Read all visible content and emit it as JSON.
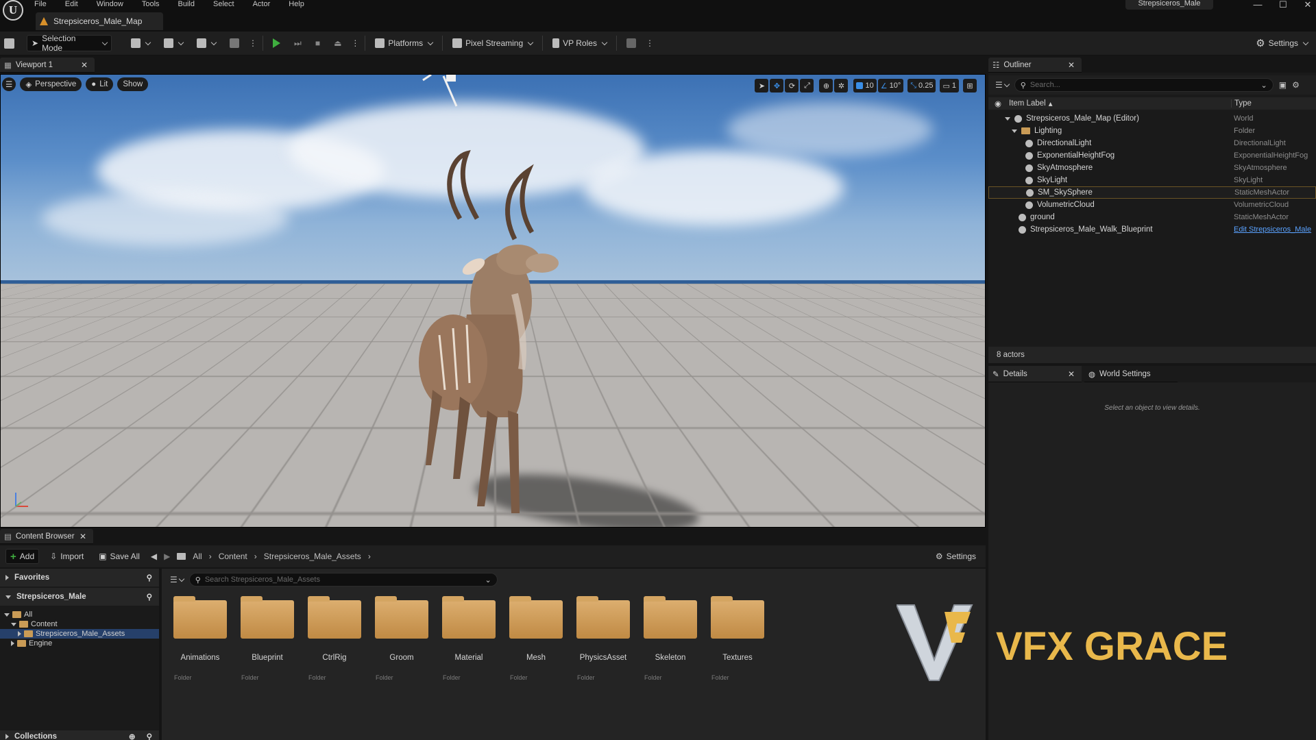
{
  "menu": [
    "File",
    "Edit",
    "Window",
    "Tools",
    "Build",
    "Select",
    "Actor",
    "Help"
  ],
  "map_tab": "Strepsiceros_Male_Map",
  "project_title": "Strepsiceros_Male",
  "toolbar": {
    "selection_mode": "Selection Mode",
    "platforms": "Platforms",
    "pixel_streaming": "Pixel Streaming",
    "vp_roles": "VP Roles",
    "settings": "Settings"
  },
  "viewport": {
    "tab": "Viewport 1",
    "perspective": "Perspective",
    "lit": "Lit",
    "show": "Show",
    "grid_snap": "10",
    "rot_snap": "10°",
    "scale_snap": "0.25",
    "camera_speed": "1"
  },
  "outliner": {
    "tab": "Outliner",
    "search_placeholder": "Search...",
    "col_label": "Item Label",
    "col_type": "Type",
    "rows": [
      {
        "label": "Strepsiceros_Male_Map (Editor)",
        "type": "World"
      },
      {
        "label": "Lighting",
        "type": "Folder"
      },
      {
        "label": "DirectionalLight",
        "type": "DirectionalLight"
      },
      {
        "label": "ExponentialHeightFog",
        "type": "ExponentialHeightFog"
      },
      {
        "label": "SkyAtmosphere",
        "type": "SkyAtmosphere"
      },
      {
        "label": "SkyLight",
        "type": "SkyLight"
      },
      {
        "label": "SM_SkySphere",
        "type": "StaticMeshActor"
      },
      {
        "label": "VolumetricCloud",
        "type": "VolumetricCloud"
      },
      {
        "label": "ground",
        "type": "StaticMeshActor"
      },
      {
        "label": "Strepsiceros_Male_Walk_Blueprint",
        "type": "Edit Strepsiceros_Male"
      }
    ],
    "actor_count": "8 actors"
  },
  "details": {
    "tab": "Details",
    "world_settings_tab": "World Settings",
    "empty_text": "Select an object to view details."
  },
  "content_browser": {
    "tab": "Content Browser",
    "add": "Add",
    "import": "Import",
    "save_all": "Save All",
    "crumbs": [
      "All",
      "Content",
      "Strepsiceros_Male_Assets"
    ],
    "settings": "Settings",
    "favorites": "Favorites",
    "project": "Strepsiceros_Male",
    "search_placeholder": "Search Strepsiceros_Male_Assets",
    "tree": [
      "All",
      "Content",
      "Strepsiceros_Male_Assets",
      "Engine"
    ],
    "collections": "Collections",
    "folder_type": "Folder",
    "folders": [
      "Animations",
      "Blueprint",
      "CtrlRig",
      "Groom",
      "Material",
      "Mesh",
      "PhysicsAsset",
      "Skeleton",
      "Textures"
    ]
  },
  "watermark": "VFX GRACE",
  "colors": {
    "accent": "#3a8ee6",
    "play": "#3fae3f",
    "folder": "#c99b56",
    "selection": "#26406a"
  }
}
